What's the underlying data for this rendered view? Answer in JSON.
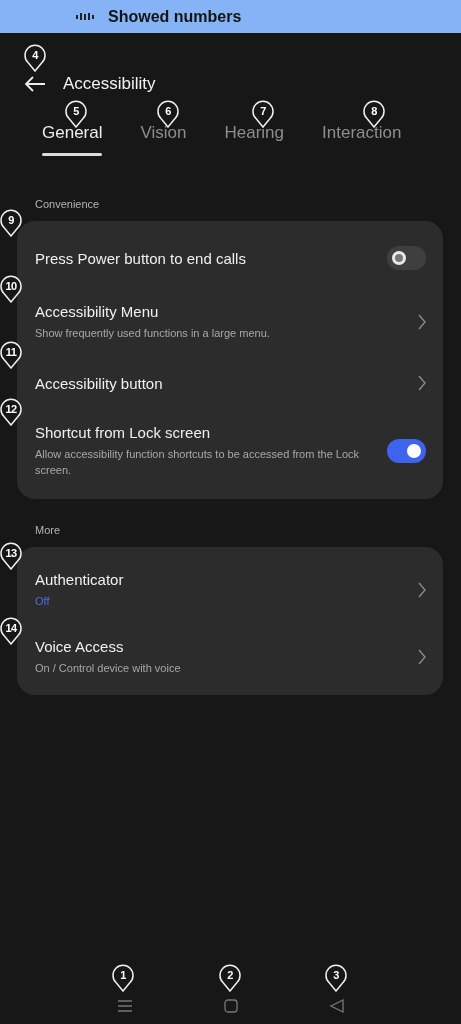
{
  "banner": {
    "text": "Showed numbers"
  },
  "header": {
    "title": "Accessibility"
  },
  "tabs": [
    {
      "label": "General",
      "selected": true
    },
    {
      "label": "Vision",
      "selected": false
    },
    {
      "label": "Hearing",
      "selected": false
    },
    {
      "label": "Interaction",
      "selected": false
    }
  ],
  "sections": [
    {
      "title": "Convenience",
      "items": [
        {
          "kind": "switch",
          "title": "Press Power button to end calls",
          "on": false
        },
        {
          "kind": "link",
          "title": "Accessibility Menu",
          "subtitle": "Show frequently used functions in a large menu.",
          "subtitle_accent": false
        },
        {
          "kind": "link",
          "title": "Accessibility button"
        },
        {
          "kind": "switch",
          "title": "Shortcut from Lock screen",
          "subtitle": "Allow accessibility function shortcuts to be accessed from the Lock screen.",
          "subtitle_accent": false,
          "on": true
        }
      ]
    },
    {
      "title": "More",
      "items": [
        {
          "kind": "link",
          "title": "Authenticator",
          "subtitle": "Off",
          "subtitle_accent": true
        },
        {
          "kind": "link",
          "title": "Voice Access",
          "subtitle": "On / Control device with voice",
          "subtitle_accent": false
        }
      ]
    }
  ],
  "nav_buttons": [
    {
      "kind": "recents"
    },
    {
      "kind": "home"
    },
    {
      "kind": "back"
    }
  ],
  "markers": [
    {
      "number": "1"
    },
    {
      "number": "2"
    },
    {
      "number": "3"
    },
    {
      "number": "4"
    },
    {
      "number": "5"
    },
    {
      "number": "6"
    },
    {
      "number": "7"
    },
    {
      "number": "8"
    },
    {
      "number": "9"
    },
    {
      "number": "10"
    },
    {
      "number": "11"
    },
    {
      "number": "12"
    },
    {
      "number": "13"
    },
    {
      "number": "14"
    }
  ]
}
